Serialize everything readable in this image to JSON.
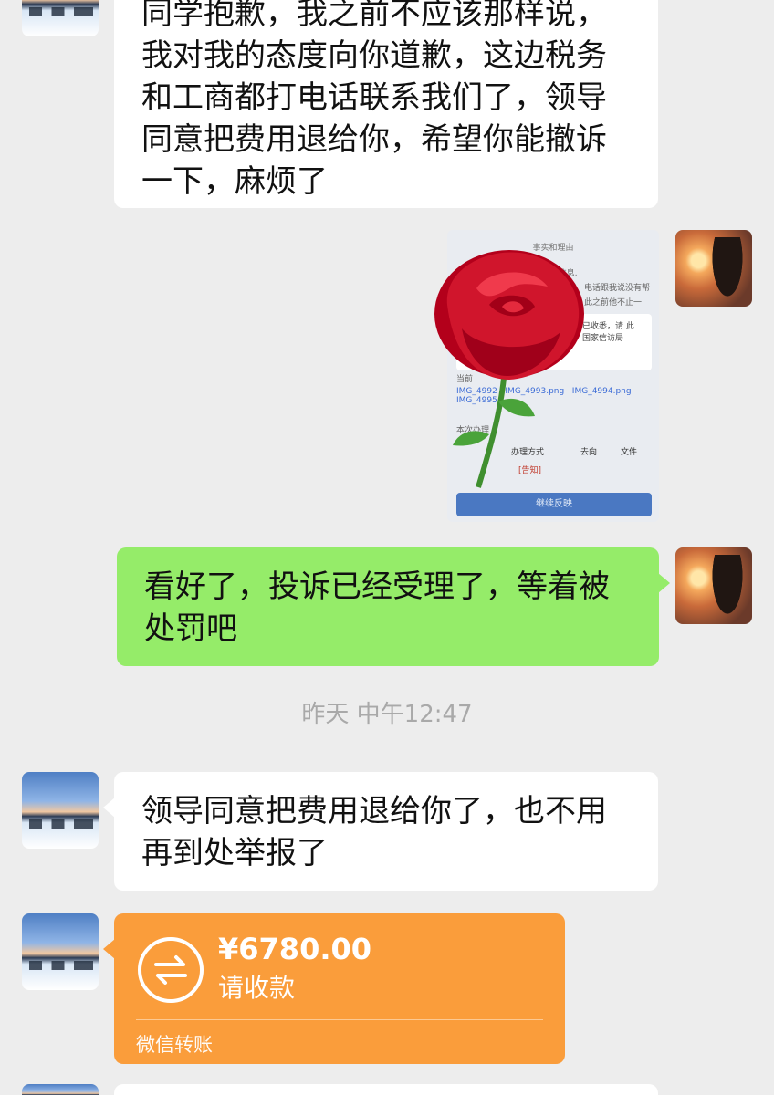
{
  "messages": {
    "m1": {
      "lines": [
        "同学抱歉，我之前不应该那样说，",
        "我对我的态度向你道歉，这边税务",
        "和工商都打电话联系我们了，领导",
        "同意把费用退给你，希望你能撤诉",
        "一下，麻烦了"
      ]
    },
    "image_msg": {
      "header": "事实和理由",
      "lines": [
        "”上看到预约考试信息,",
        "电话跟我说没有帮",
        "此之前他不止一"
      ],
      "notice": "事项已收悉，请 此复。国家信访局",
      "label_dang": "当前",
      "links": [
        "IMG_4992",
        "IMG_4993.png",
        "IMG_4994.png",
        "IMG_4995"
      ],
      "section": "本次办理",
      "table_headers": [
        "办理方式",
        "去向",
        "文件"
      ],
      "tag": "[告知]",
      "cta": "继续反映"
    },
    "m2": {
      "lines": [
        "看好了，投诉已经受理了，等着被",
        "处罚吧"
      ]
    },
    "timestamp": "昨天 中午12:47",
    "m3": {
      "lines": [
        "领导同意把费用退给你了，也不用",
        "再到处举报了"
      ]
    },
    "transfer": {
      "amount": "¥6780.00",
      "status": "请收款",
      "footer": "微信转账"
    }
  },
  "colors": {
    "background": "#ededed",
    "incoming_bubble": "#ffffff",
    "outgoing_bubble": "#95ec69",
    "transfer_bubble": "#fa9d3b"
  },
  "icons": {
    "transfer": "transfer-arrows-icon",
    "rose": "rose-sticker"
  }
}
